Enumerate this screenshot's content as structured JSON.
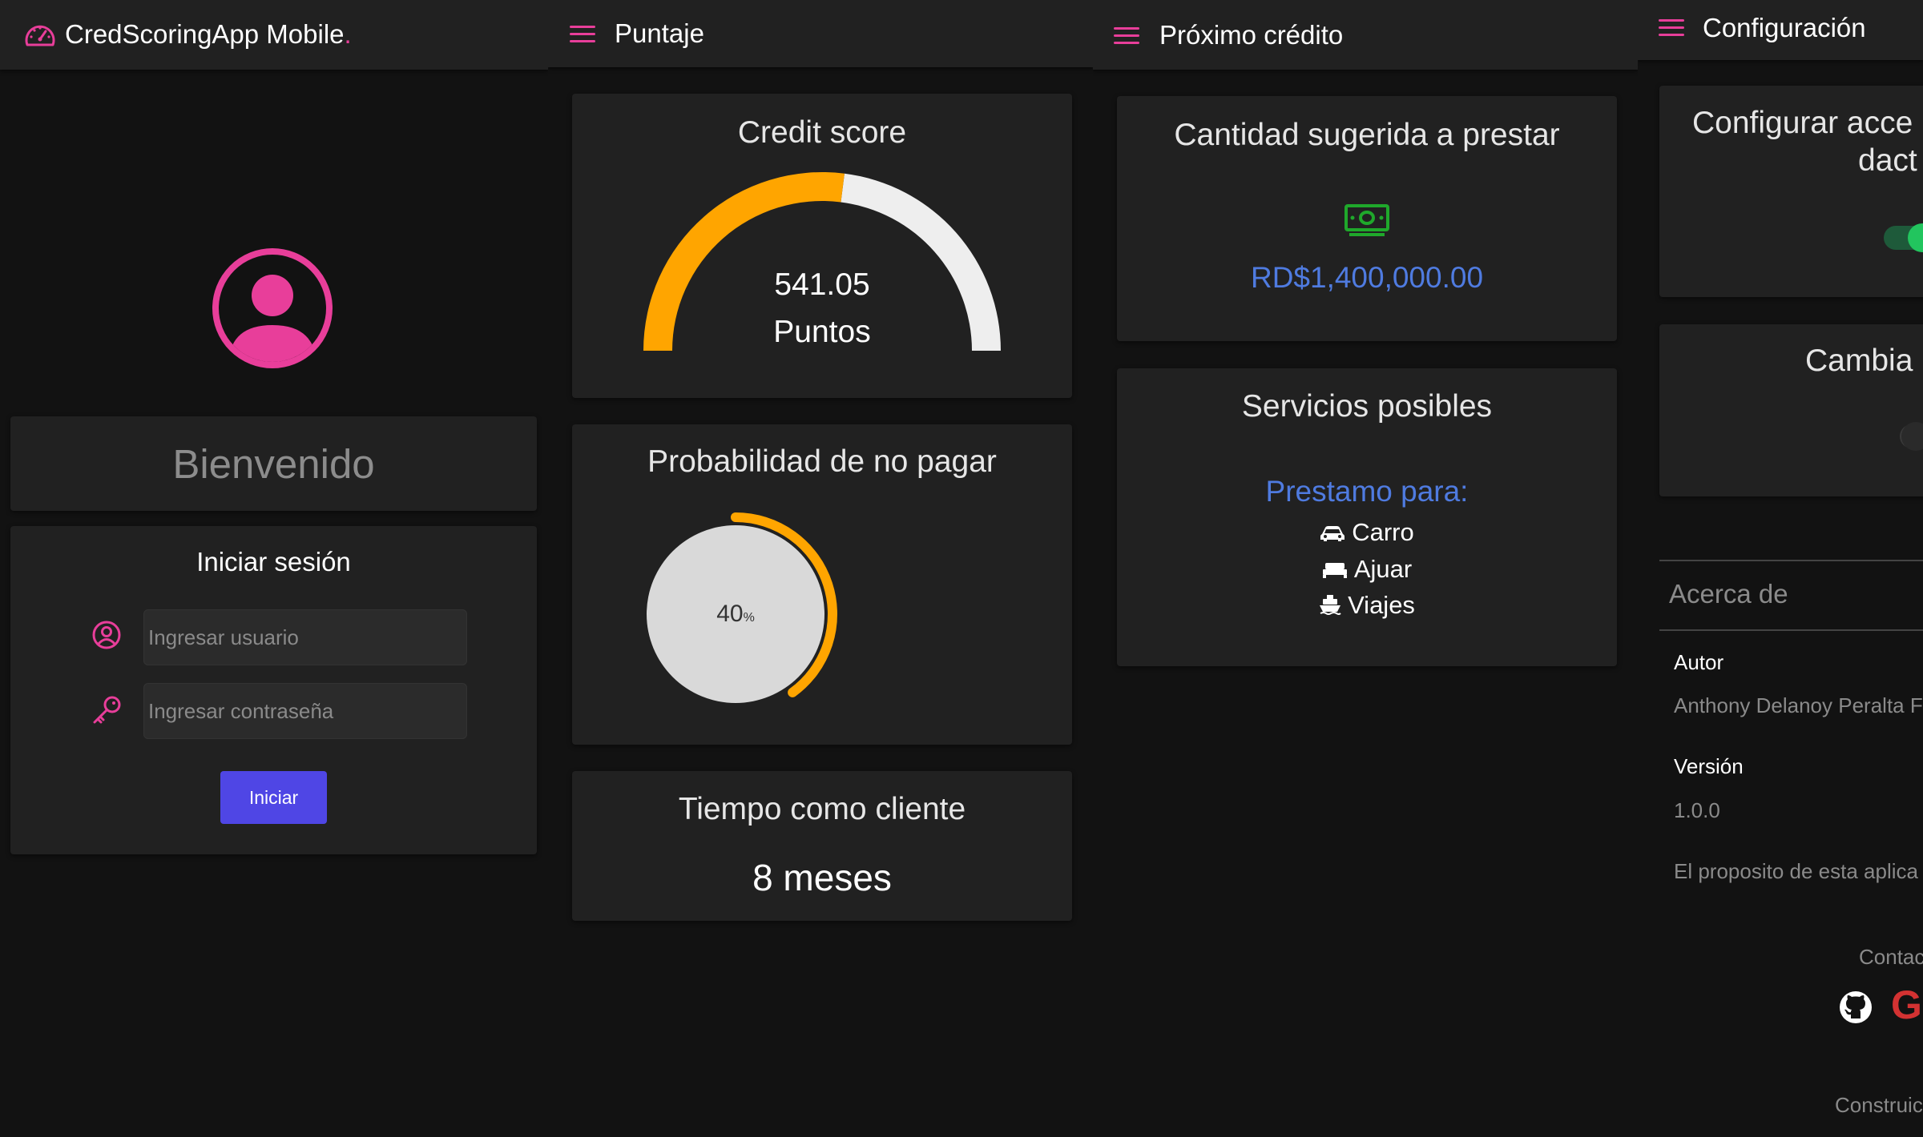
{
  "login_screen": {
    "app_title": "CredScoringApp Mobile",
    "app_title_dot": ".",
    "welcome": "Bienvenido",
    "login_title": "Iniciar sesión",
    "username_placeholder": "Ingresar usuario",
    "password_placeholder": "Ingresar contraseña",
    "submit_label": "Iniciar"
  },
  "score_screen": {
    "title": "Puntaje",
    "credit_card": {
      "title": "Credit score",
      "value": "541.05",
      "unit": "Puntos",
      "gauge_fraction": 0.54,
      "gauge_color": "#ffa500",
      "track_color": "#eeeeee"
    },
    "default_card": {
      "title": "Probabilidad de no pagar",
      "value": "40",
      "unit": "%",
      "percent": 40
    },
    "tenure_card": {
      "title": "Tiempo como cliente",
      "value": "8 meses"
    }
  },
  "next_credit_screen": {
    "title": "Próximo crédito",
    "amount_card": {
      "title": "Cantidad sugerida a prestar",
      "amount": "RD$1,400,000.00",
      "icon": "money-bill-icon"
    },
    "services_card": {
      "title": "Servicios posibles",
      "subtitle": "Prestamo para:",
      "items": [
        {
          "label": "Carro",
          "icon": "car-icon"
        },
        {
          "label": "Ajuar",
          "icon": "bed-icon"
        },
        {
          "label": "Viajes",
          "icon": "ship-icon"
        }
      ]
    }
  },
  "settings_screen": {
    "title": "Configuración",
    "fingerprint_card": {
      "title_line1": "Configurar acce",
      "title_line2": "dact"
    },
    "theme_card": {
      "title": "Cambia"
    },
    "about": {
      "header": "Acerca de",
      "author_label": "Autor",
      "author_value": "Anthony Delanoy Peralta F",
      "version_label": "Versión",
      "version_value": "1.0.0",
      "purpose_text": "El proposito de esta aplica",
      "contact_label": "Contac",
      "built_label": "Construic"
    }
  },
  "colors": {
    "accent_pink": "#e83e9a",
    "primary_button": "#4f46e5",
    "link_blue": "#4f7be0",
    "money_green": "#1fa82b",
    "gauge_orange": "#ffa500"
  }
}
